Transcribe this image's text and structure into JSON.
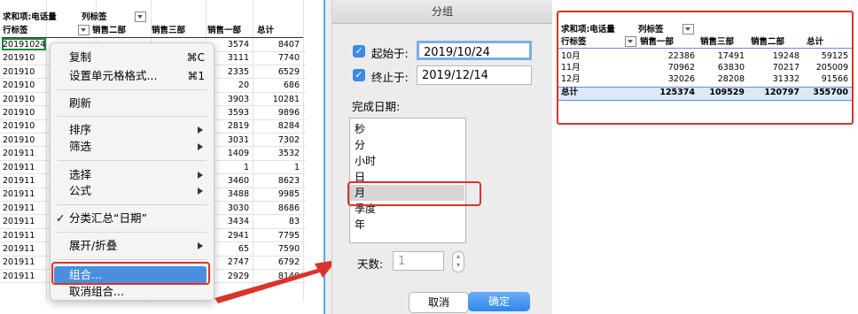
{
  "left_sheet": {
    "pivot_label": "求和项:电话量",
    "col_label": "列标签",
    "row_label": "行标签",
    "headers": [
      "销售二部",
      "销售三部",
      "销售一部",
      "总计"
    ],
    "rows": [
      {
        "date": "20191024",
        "c1": "",
        "c2": "",
        "c3": "3574",
        "total": "8407"
      },
      {
        "date": "201910",
        "c1": "",
        "c2": "",
        "c3": "3111",
        "total": "7740"
      },
      {
        "date": "201910",
        "c1": "",
        "c2": "",
        "c3": "2335",
        "total": "6529"
      },
      {
        "date": "201910",
        "c1": "",
        "c2": "",
        "c3": "20",
        "total": "686"
      },
      {
        "date": "201910",
        "c1": "",
        "c2": "",
        "c3": "3903",
        "total": "10281"
      },
      {
        "date": "201910",
        "c1": "",
        "c2": "",
        "c3": "3593",
        "total": "9896"
      },
      {
        "date": "201910",
        "c1": "",
        "c2": "",
        "c3": "2819",
        "total": "8284"
      },
      {
        "date": "201910",
        "c1": "",
        "c2": "",
        "c3": "3031",
        "total": "7302"
      },
      {
        "date": "201911",
        "c1": "",
        "c2": "",
        "c3": "1409",
        "total": "3532"
      },
      {
        "date": "201911",
        "c1": "",
        "c2": "",
        "c3": "1",
        "total": "1"
      },
      {
        "date": "201911",
        "c1": "",
        "c2": "",
        "c3": "3460",
        "total": "8623"
      },
      {
        "date": "201911",
        "c1": "",
        "c2": "",
        "c3": "3488",
        "total": "9985"
      },
      {
        "date": "201911",
        "c1": "",
        "c2": "",
        "c3": "3030",
        "total": "8686"
      },
      {
        "date": "201911",
        "c1": "",
        "c2": "",
        "c3": "3434",
        "total": "83"
      },
      {
        "date": "201911",
        "c1": "",
        "c2": "",
        "c3": "2941",
        "total": "7795"
      },
      {
        "date": "201911",
        "c1": "",
        "c2": "",
        "c3": "65",
        "total": "7590"
      },
      {
        "date": "201911",
        "c1": "",
        "c2": "",
        "c3": "2747",
        "total": "6792"
      },
      {
        "date": "201911",
        "c1": "",
        "c2": "",
        "c3": "2929",
        "total": "8140"
      }
    ]
  },
  "context_menu": {
    "copy": {
      "label": "复制",
      "shortcut": "⌘C"
    },
    "format": {
      "label": "设置单元格格式...",
      "shortcut": "⌘1"
    },
    "refresh": "刷新",
    "sort": "排序",
    "filter": "筛选",
    "select": "选择",
    "formula": "公式",
    "subtotal": "分类汇总“日期”",
    "subtotal_check": "✓",
    "expand": "展开/折叠",
    "group": "组合...",
    "ungroup": "取消组合..."
  },
  "group_dialog": {
    "title": "分组",
    "start_label": "起始于:",
    "start_value": "2019/10/24",
    "end_label": "终止于:",
    "end_value": "2019/12/14",
    "by_label": "完成日期:",
    "units": [
      "秒",
      "分",
      "小时",
      "日",
      "月",
      "季度",
      "年"
    ],
    "selected_unit": "月",
    "days_label": "天数:",
    "days_value": "1",
    "cancel": "取消",
    "ok": "确定",
    "check_mark": "✓"
  },
  "right_sheet": {
    "pivot_label": "求和项:电话量",
    "col_label": "列标签",
    "row_label": "行标签",
    "headers": [
      "销售一部",
      "销售三部",
      "销售二部",
      "总计"
    ],
    "rows": [
      {
        "month": "10月",
        "v1": "22386",
        "v2": "17491",
        "v3": "19248",
        "total": "59125"
      },
      {
        "month": "11月",
        "v1": "70962",
        "v2": "63830",
        "v3": "70217",
        "total": "205009"
      },
      {
        "month": "12月",
        "v1": "32026",
        "v2": "28208",
        "v3": "31332",
        "total": "91566"
      }
    ],
    "grand_total": {
      "label": "总计",
      "v1": "125374",
      "v2": "109529",
      "v3": "120797",
      "total": "355700"
    }
  },
  "colors": {
    "highlight": "#4a8fdd",
    "annotation_red": "#d9342b",
    "checkbox_blue": "#3b8ae6",
    "pivot_blue": "#dbe8f6"
  }
}
